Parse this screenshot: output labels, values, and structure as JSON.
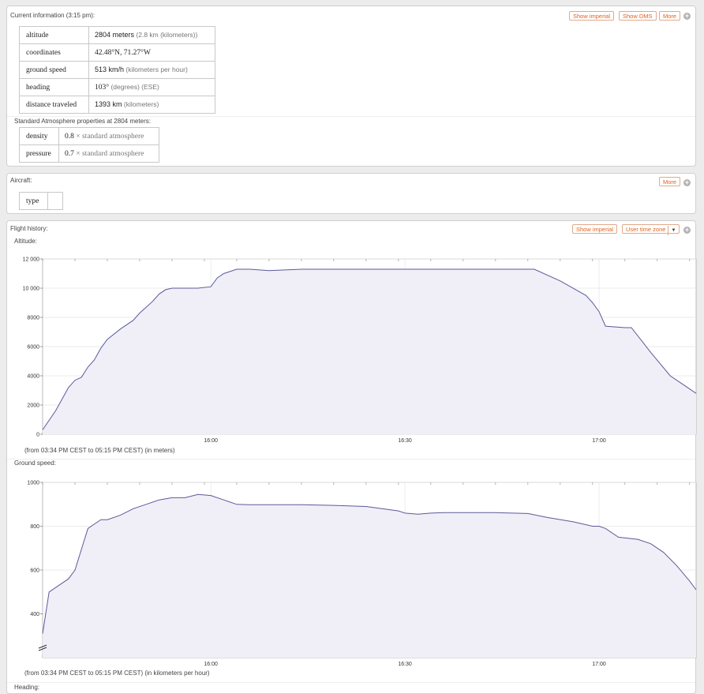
{
  "current": {
    "title": "Current information (3:15 pm):",
    "buttons": {
      "imperial": "Show imperial",
      "dms": "Show DMS",
      "more": "More"
    },
    "rows": [
      {
        "label": "altitude",
        "value": "2804 meters",
        "unit": "(2.8 km (kilometers))"
      },
      {
        "label": "coordinates",
        "value": "42.48°N, 71.27°W",
        "unit": ""
      },
      {
        "label": "ground speed",
        "value": "513 km/h",
        "unit": "(kilometers per hour)"
      },
      {
        "label": "heading",
        "value": "103°",
        "unit": "(degrees)  (ESE)"
      },
      {
        "label": "distance traveled",
        "value": "1393 km",
        "unit": "(kilometers)"
      }
    ],
    "atm_title": "Standard Atmosphere properties at 2804 meters:",
    "atm_rows": [
      {
        "label": "density",
        "value": "0.8",
        "unit": "× standard atmosphere"
      },
      {
        "label": "pressure",
        "value": "0.7",
        "unit": "× standard atmosphere"
      }
    ]
  },
  "aircraft": {
    "title": "Aircraft:",
    "more": "More",
    "type_label": "type",
    "type_value": ""
  },
  "history": {
    "title": "Flight history:",
    "buttons": {
      "imperial": "Show imperial",
      "tz": "User time zone"
    },
    "next_title": "Heading:"
  },
  "chart_data": [
    {
      "type": "area",
      "title": "Altitude:",
      "caption": "(from 03:34 PM CEST to 05:15 PM CEST)  (in meters)",
      "xlim": [
        0,
        101
      ],
      "ylim": [
        0,
        12000
      ],
      "grid": true,
      "x_ticks": [
        {
          "x": 26,
          "label": "16:00"
        },
        {
          "x": 56,
          "label": "16:30"
        },
        {
          "x": 86,
          "label": "17:00"
        }
      ],
      "y_ticks": [
        {
          "y": 0,
          "label": "0"
        },
        {
          "y": 2000,
          "label": "2000"
        },
        {
          "y": 4000,
          "label": "4000"
        },
        {
          "y": 6000,
          "label": "6000"
        },
        {
          "y": 8000,
          "label": "8000"
        },
        {
          "y": 10000,
          "label": "10 000"
        },
        {
          "y": 12000,
          "label": "12 000"
        }
      ],
      "y_break": false,
      "x": [
        0,
        2,
        4,
        5,
        6,
        7,
        8,
        9,
        10,
        12,
        14,
        15,
        16,
        17,
        18,
        19,
        20,
        21,
        22,
        24,
        26,
        27,
        28,
        30,
        32,
        35,
        40,
        50,
        60,
        70,
        76,
        80,
        84,
        85,
        86,
        87,
        90,
        91,
        94,
        97,
        99,
        101
      ],
      "y": [
        300,
        1600,
        3200,
        3700,
        3900,
        4600,
        5100,
        5900,
        6500,
        7200,
        7800,
        8300,
        8700,
        9100,
        9600,
        9900,
        10000,
        10000,
        10000,
        10000,
        10100,
        10700,
        11000,
        11300,
        11300,
        11200,
        11300,
        11300,
        11300,
        11300,
        11300,
        10500,
        9500,
        9000,
        8400,
        7400,
        7300,
        7300,
        5600,
        4000,
        3400,
        2800
      ]
    },
    {
      "type": "area",
      "title": "Ground speed:",
      "caption": "(from 03:34 PM CEST to 05:15 PM CEST)  (in kilometers per hour)",
      "xlim": [
        0,
        101
      ],
      "ylim": [
        200,
        1000
      ],
      "grid": true,
      "x_ticks": [
        {
          "x": 26,
          "label": "16:00"
        },
        {
          "x": 56,
          "label": "16:30"
        },
        {
          "x": 86,
          "label": "17:00"
        }
      ],
      "y_ticks": [
        {
          "y": 400,
          "label": "400"
        },
        {
          "y": 600,
          "label": "600"
        },
        {
          "y": 800,
          "label": "800"
        },
        {
          "y": 1000,
          "label": "1000"
        }
      ],
      "y_break": true,
      "x": [
        0,
        1,
        3,
        4,
        5,
        7,
        9,
        10,
        12,
        14,
        16,
        18,
        20,
        22,
        24,
        26,
        28,
        30,
        32,
        35,
        40,
        45,
        50,
        55,
        56,
        58,
        60,
        62,
        65,
        70,
        75,
        78,
        82,
        85,
        86,
        87,
        89,
        92,
        94,
        96,
        98,
        100,
        101
      ],
      "y": [
        310,
        500,
        540,
        560,
        600,
        790,
        830,
        830,
        850,
        880,
        900,
        920,
        930,
        930,
        945,
        940,
        920,
        900,
        898,
        898,
        898,
        895,
        890,
        870,
        860,
        855,
        860,
        862,
        862,
        862,
        858,
        840,
        820,
        800,
        800,
        790,
        750,
        740,
        720,
        680,
        620,
        550,
        510
      ]
    }
  ]
}
